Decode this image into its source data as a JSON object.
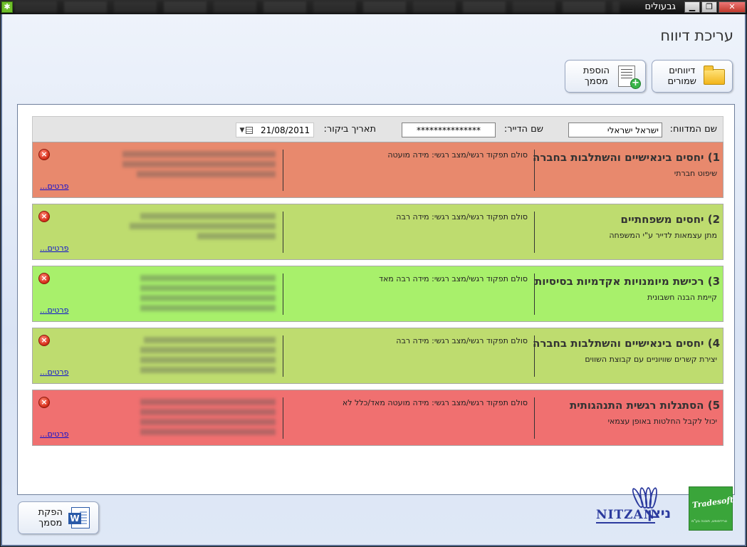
{
  "window": {
    "title": "גבעולים",
    "minimize": "▁",
    "restore": "❐",
    "close": "✕"
  },
  "page": {
    "title": "עריכת דיווח"
  },
  "toolbar": {
    "saved_reports": "דיווחים\nשמורים",
    "add_document": "הוספת\nמסמך",
    "generate_document": "הפקת\nמסמך"
  },
  "form": {
    "reporter_label": "שם המדווח:",
    "reporter_value": "ישראל ישראלי",
    "resident_label": "שם הדייר:",
    "resident_value": "***************",
    "visit_date_label": "תאריך ביקור:",
    "visit_date_value": "21/08/2011"
  },
  "cards": [
    {
      "title": "1) יחסים בינאישיים והשתלבות בחברה",
      "subtitle": "שיפוט חברתי",
      "scale": "סולם תפקוד רגשי/מצב רגשי: מידה מועטה",
      "link": "פרטים...",
      "color": "#e8896d"
    },
    {
      "title": "2) יחסים משפחתיים",
      "subtitle": "מתן עצמאות לדייר ע\"י המשפחה",
      "scale": "סולם תפקוד רגשי/מצב רגשי: מידה רבה",
      "link": "פרטים...",
      "color": "#bedc6f"
    },
    {
      "title": "3) רכישת מיומנויות אקדמיות בסיסיות",
      "subtitle": "קיימת הבנה חשבונית",
      "scale": "סולם תפקוד רגשי/מצב רגשי: מידה רבה מאד",
      "link": "פרטים...",
      "color": "#a8f06b"
    },
    {
      "title": "4) יחסים בינאישיים והשתלבות בחברה",
      "subtitle": "יצירת קשרים שוויוניים עם קבוצת השווים",
      "scale": "סולם תפקוד רגשי/מצב רגשי: מידה רבה",
      "link": "פרטים...",
      "color": "#bedc6f"
    },
    {
      "title": "5) הסתגלות רגשית התנהגותית",
      "subtitle": "יכול לקבל החלטות באופן עצמאי",
      "scale": "סולם תפקוד רגשי/מצב רגשי: מידה מועטה מאד/כלל לא",
      "link": "פרטים...",
      "color": "#f07070"
    }
  ],
  "logos": {
    "nitzan_hebrew": "ניצן",
    "nitzan_latin": "NITZAN",
    "tradesoft": "Tradesoft",
    "tradesoft_tagline": "טרידסופט, תוכנה בע\"מ"
  },
  "colors": {
    "accent_blue": "#2b3a9e",
    "panel_border": "#6e7f9c"
  },
  "icons": [
    "app-icon",
    "folder-icon",
    "document-add-icon",
    "word-document-icon",
    "remove-icon",
    "calendar-icon"
  ]
}
